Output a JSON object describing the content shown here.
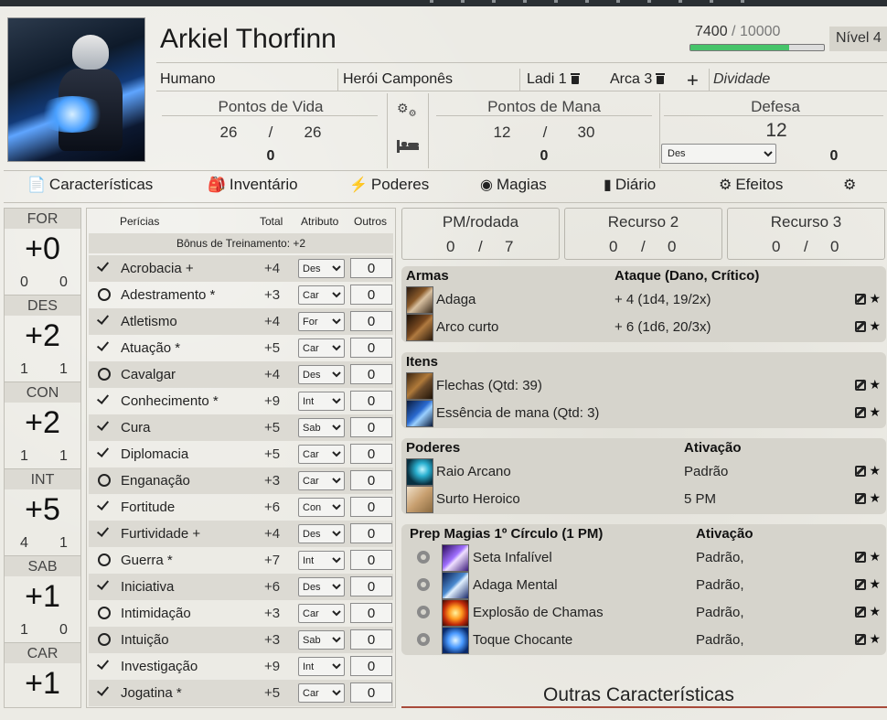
{
  "character": {
    "name": "Arkiel Thorfinn",
    "xp_current": "7400",
    "xp_max": "/ 10000",
    "xp_fraction": 0.74,
    "level": "Nível 4",
    "race": "Humano",
    "origin": "Herói Camponês",
    "class1": "Ladi 1",
    "class2": "Arca 3",
    "add": "+",
    "divinity_placeholder": "Dividade"
  },
  "stats": {
    "hp_label": "Pontos de Vida",
    "hp_current": "26",
    "hp_sep": "/",
    "hp_max": "26",
    "hp_temp": "0",
    "mp_label": "Pontos de Mana",
    "mp_current": "12",
    "mp_sep": "/",
    "mp_max": "30",
    "mp_temp": "0",
    "def_label": "Defesa",
    "def_value": "12",
    "def_attr": "Des",
    "def_other": "0"
  },
  "tabs": [
    {
      "label": "Características",
      "icon": "doc-icon"
    },
    {
      "label": "Inventário",
      "icon": "backpack-icon"
    },
    {
      "label": "Poderes",
      "icon": "bolt-icon"
    },
    {
      "label": "Magias",
      "icon": "swirl-icon"
    },
    {
      "label": "Diário",
      "icon": "book-icon"
    },
    {
      "label": "Efeitos",
      "icon": "gear-icon"
    }
  ],
  "attributes": [
    {
      "label": "FOR",
      "value": "+0",
      "l": "0",
      "r": "0"
    },
    {
      "label": "DES",
      "value": "+2",
      "l": "1",
      "r": "1"
    },
    {
      "label": "CON",
      "value": "+2",
      "l": "1",
      "r": "1"
    },
    {
      "label": "INT",
      "value": "+5",
      "l": "4",
      "r": "1"
    },
    {
      "label": "SAB",
      "value": "+1",
      "l": "1",
      "r": "0"
    },
    {
      "label": "CAR",
      "value": "+1",
      "l": "",
      "r": ""
    }
  ],
  "skills_header": {
    "name": "Perícias",
    "total": "Total",
    "attr": "Atributo",
    "other": "Outros"
  },
  "training_bonus": "Bônus de Treinamento: +2",
  "skills": [
    {
      "name": "Acrobacia +",
      "trained": true,
      "total": "+4",
      "attr": "Des",
      "other": "0"
    },
    {
      "name": "Adestramento *",
      "trained": false,
      "total": "+3",
      "attr": "Car",
      "other": "0"
    },
    {
      "name": "Atletismo",
      "trained": true,
      "total": "+4",
      "attr": "For",
      "other": "0"
    },
    {
      "name": "Atuação *",
      "trained": true,
      "total": "+5",
      "attr": "Car",
      "other": "0"
    },
    {
      "name": "Cavalgar",
      "trained": false,
      "total": "+4",
      "attr": "Des",
      "other": "0"
    },
    {
      "name": "Conhecimento *",
      "trained": true,
      "total": "+9",
      "attr": "Int",
      "other": "0"
    },
    {
      "name": "Cura",
      "trained": true,
      "total": "+5",
      "attr": "Sab",
      "other": "0"
    },
    {
      "name": "Diplomacia",
      "trained": true,
      "total": "+5",
      "attr": "Car",
      "other": "0"
    },
    {
      "name": "Enganação",
      "trained": false,
      "total": "+3",
      "attr": "Car",
      "other": "0"
    },
    {
      "name": "Fortitude",
      "trained": true,
      "total": "+6",
      "attr": "Con",
      "other": "0"
    },
    {
      "name": "Furtividade +",
      "trained": true,
      "total": "+4",
      "attr": "Des",
      "other": "0"
    },
    {
      "name": "Guerra *",
      "trained": false,
      "total": "+7",
      "attr": "Int",
      "other": "0"
    },
    {
      "name": "Iniciativa",
      "trained": true,
      "total": "+6",
      "attr": "Des",
      "other": "0"
    },
    {
      "name": "Intimidação",
      "trained": false,
      "total": "+3",
      "attr": "Car",
      "other": "0"
    },
    {
      "name": "Intuição",
      "trained": false,
      "total": "+3",
      "attr": "Sab",
      "other": "0"
    },
    {
      "name": "Investigação",
      "trained": true,
      "total": "+9",
      "attr": "Int",
      "other": "0"
    },
    {
      "name": "Jogatina *",
      "trained": true,
      "total": "+5",
      "attr": "Car",
      "other": "0"
    }
  ],
  "resources": [
    {
      "title": "PM/rodada",
      "a": "0",
      "sep": "/",
      "b": "7"
    },
    {
      "title": "Recurso 2",
      "a": "0",
      "sep": "/",
      "b": "0"
    },
    {
      "title": "Recurso 3",
      "a": "0",
      "sep": "/",
      "b": "0"
    }
  ],
  "weapons": {
    "title": "Armas",
    "col2": "Ataque (Dano, Crítico)",
    "items": [
      {
        "name": "Adaga",
        "value": "+ 4 (1d4, 19/2x)",
        "icon": "dagger-icon"
      },
      {
        "name": "Arco curto",
        "value": "+ 6 (1d6, 20/3x)",
        "icon": "bow-icon"
      }
    ]
  },
  "items": {
    "title": "Itens",
    "items": [
      {
        "name": "Flechas (Qtd: 39)",
        "icon": "arrows-icon"
      },
      {
        "name": "Essência de mana (Qtd: 3)",
        "icon": "potion-icon"
      }
    ]
  },
  "powers": {
    "title": "Poderes",
    "col2": "Ativação",
    "items": [
      {
        "name": "Raio Arcano",
        "value": "Padrão",
        "icon": "arcane-bolt-icon"
      },
      {
        "name": "Surto Heroico",
        "value": "5 PM",
        "icon": "heroic-surge-icon"
      }
    ]
  },
  "spells": {
    "title": "Prep Magias 1º Círculo (1 PM)",
    "col2": "Ativação",
    "items": [
      {
        "name": "Seta Infalível",
        "value": "Padrão,",
        "icon": "magic-missile-icon"
      },
      {
        "name": "Adaga Mental",
        "value": "Padrão,",
        "icon": "mental-dagger-icon"
      },
      {
        "name": "Explosão de Chamas",
        "value": "Padrão,",
        "icon": "flame-burst-icon"
      },
      {
        "name": "Toque Chocante",
        "value": "Padrão,",
        "icon": "shocking-touch-icon"
      }
    ]
  },
  "other_features_title": "Outras Características",
  "colors": {
    "xp_fill": "#46c46a",
    "accent_line": "#a84a3a",
    "panel": "#d6d4cc"
  }
}
